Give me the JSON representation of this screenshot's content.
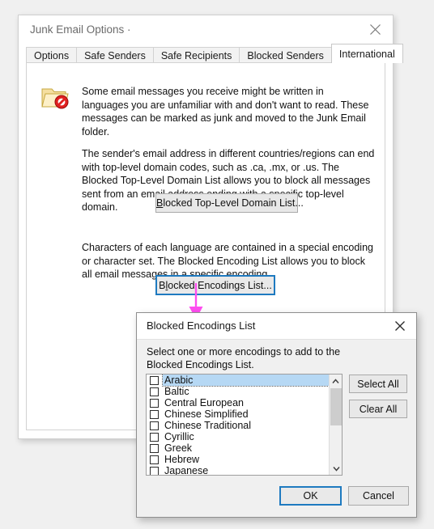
{
  "outer_dialog": {
    "title": "Junk Email Options ·",
    "close_icon": "close-icon",
    "tabs": [
      {
        "label": "Options",
        "active": false
      },
      {
        "label": "Safe Senders",
        "active": false
      },
      {
        "label": "Safe Recipients",
        "active": false
      },
      {
        "label": "Blocked Senders",
        "active": false
      },
      {
        "label": "International",
        "active": true
      }
    ],
    "intro_icon": "blocked-folder-icon",
    "intro_text": "Some email messages you receive might be written in languages you are unfamiliar with and don't want to read. These messages can be marked as junk and moved to the Junk Email folder.",
    "tld_text": "The sender's email address in different countries/regions can end with top-level domain codes, such as .ca, .mx, or .us. The Blocked Top-Level Domain List allows you to block all messages sent from an email address ending with a specific top-level domain.",
    "tld_button": {
      "accel": "B",
      "rest": "locked Top-Level Domain List..."
    },
    "encoding_text": "Characters of each language are contained in a special encoding or character set. The Blocked Encoding List allows you to block all email messages in a specific encoding.",
    "encoding_button": {
      "pre": "B",
      "accel": "l",
      "rest": "ocked Encodings List..."
    }
  },
  "annotation": {
    "arrow_color": "#ff4df0",
    "arrow_name": "pink-down-arrow"
  },
  "inner_dialog": {
    "title": "Blocked Encodings List",
    "close_icon": "close-icon",
    "instruction": "Select one or more encodings to add to the Blocked Encodings List.",
    "list_items": [
      {
        "label": "Arabic",
        "checked": false,
        "selected": true
      },
      {
        "label": "Baltic",
        "checked": false,
        "selected": false
      },
      {
        "label": "Central European",
        "checked": false,
        "selected": false
      },
      {
        "label": "Chinese Simplified",
        "checked": false,
        "selected": false
      },
      {
        "label": "Chinese Traditional",
        "checked": false,
        "selected": false
      },
      {
        "label": "Cyrillic",
        "checked": false,
        "selected": false
      },
      {
        "label": "Greek",
        "checked": false,
        "selected": false
      },
      {
        "label": "Hebrew",
        "checked": false,
        "selected": false
      },
      {
        "label": "Japanese",
        "checked": false,
        "selected": false
      }
    ],
    "scrollbar": {
      "up_arrow": "chevron-up-icon",
      "down_arrow": "chevron-down-icon"
    },
    "select_all_label": "Select All",
    "clear_all_label": "Clear All",
    "ok_label": "OK",
    "cancel_label": "Cancel"
  },
  "colors": {
    "accent_focus_border": "#1e7ac0",
    "selection_highlight": "#b6d8f4",
    "annotation_pink": "#ff4df0",
    "page_background": "#f0f0f0"
  }
}
